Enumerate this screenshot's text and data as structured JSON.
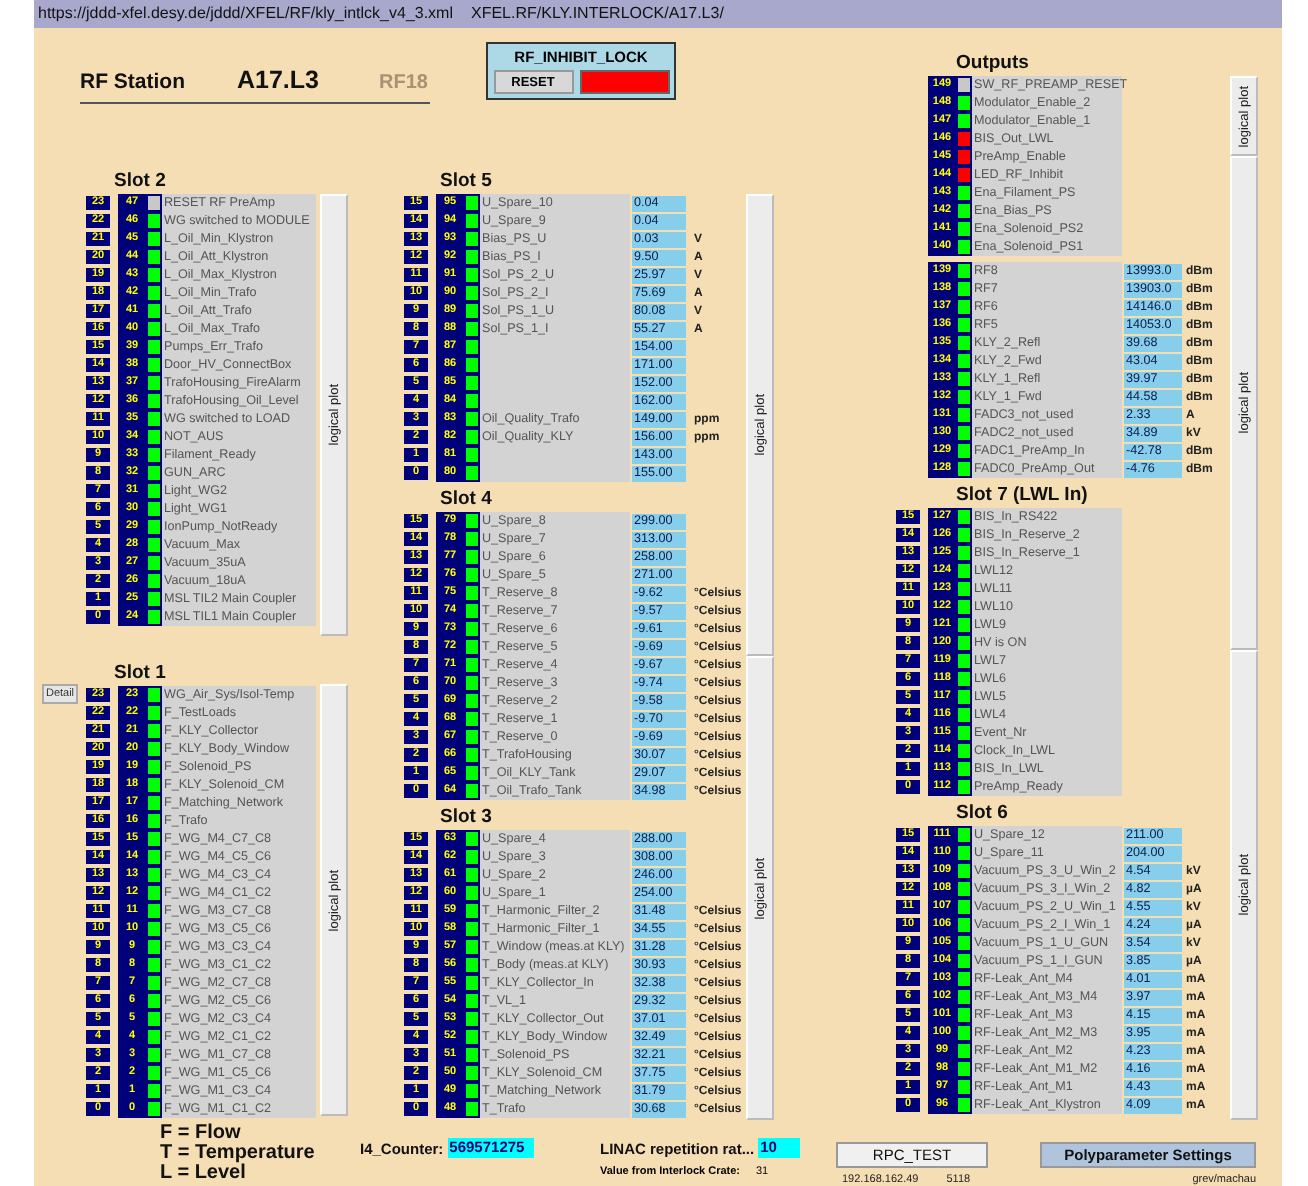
{
  "location": {
    "url": "https://jddd-xfel.desy.de/jddd/XFEL/RF/kly_intlck_v4_3.xml",
    "address": "XFEL.RF/KLY.INTERLOCK/A17.L3/"
  },
  "header": {
    "label": "RF Station",
    "station": "A17.L3",
    "rf_station": {
      "text": "RF18",
      "disabled": true
    }
  },
  "inhibit_lock": {
    "title": "RF_INHIBIT_LOCK",
    "button": "RESET",
    "color": "#ff0000"
  },
  "columns": [
    {
      "plot_buttons": [
        "logical plot",
        "logical plot"
      ],
      "slots": [
        {
          "title": "Slot 2",
          "rows": [
            {
              "index": "23",
              "bit": "47",
              "label": "RESET  RF  PreAmp",
              "color": "#c8c8c8"
            },
            {
              "index": "22",
              "bit": "46",
              "label": "WG switched to MODULE",
              "color": "#00ff00"
            },
            {
              "index": "21",
              "bit": "45",
              "label": "L_Oil_Min_Klystron",
              "color": "#00ff00"
            },
            {
              "index": "20",
              "bit": "44",
              "label": "L_Oil_Att_Klystron",
              "color": "#00ff00"
            },
            {
              "index": "19",
              "bit": "43",
              "label": "L_Oil_Max_Klystron",
              "color": "#00ff00"
            },
            {
              "index": "18",
              "bit": "42",
              "label": "L_Oil_Min_Trafo",
              "color": "#00ff00"
            },
            {
              "index": "17",
              "bit": "41",
              "label": "L_Oil_Att_Trafo",
              "color": "#00ff00"
            },
            {
              "index": "16",
              "bit": "40",
              "label": "L_Oil_Max_Trafo",
              "color": "#00ff00"
            },
            {
              "index": "15",
              "bit": "39",
              "label": "Pumps_Err_Trafo",
              "color": "#00ff00"
            },
            {
              "index": "14",
              "bit": "38",
              "label": "Door_HV_ConnectBox",
              "color": "#00ff00"
            },
            {
              "index": "13",
              "bit": "37",
              "label": "TrafoHousing_FireAlarm",
              "color": "#00ff00"
            },
            {
              "index": "12",
              "bit": "36",
              "label": "TrafoHousing_Oil_Level",
              "color": "#00ff00"
            },
            {
              "index": "11",
              "bit": "35",
              "label": "WG switched to LOAD",
              "color": "#00ff00"
            },
            {
              "index": "10",
              "bit": "34",
              "label": "NOT_AUS",
              "color": "#00ff00"
            },
            {
              "index": "9",
              "bit": "33",
              "label": "Filament_Ready",
              "color": "#00ff00"
            },
            {
              "index": "8",
              "bit": "32",
              "label": "GUN_ARC",
              "color": "#00ff00"
            },
            {
              "index": "7",
              "bit": "31",
              "label": "Light_WG2",
              "color": "#00ff00"
            },
            {
              "index": "6",
              "bit": "30",
              "label": "Light_WG1",
              "color": "#00ff00"
            },
            {
              "index": "5",
              "bit": "29",
              "label": "IonPump_NotReady",
              "color": "#00ff00"
            },
            {
              "index": "4",
              "bit": "28",
              "label": "Vacuum_Max",
              "color": "#00ff00"
            },
            {
              "index": "3",
              "bit": "27",
              "label": "Vacuum_35uA",
              "color": "#00ff00"
            },
            {
              "index": "2",
              "bit": "26",
              "label": "Vacuum_18uA",
              "color": "#00ff00"
            },
            {
              "index": "1",
              "bit": "25",
              "label": "MSL TIL2 Main Coupler",
              "color": "#00ff00"
            },
            {
              "index": "0",
              "bit": "24",
              "label": "MSL TIL1 Main Coupler",
              "color": "#00ff00"
            }
          ]
        },
        {
          "title": "Slot 1",
          "detail_button": "Detail",
          "rows": [
            {
              "index": "23",
              "bit": "23",
              "label": "WG_Air_Sys/Isol-Temp",
              "color": "#00ff00"
            },
            {
              "index": "22",
              "bit": "22",
              "label": "F_TestLoads",
              "color": "#00ff00"
            },
            {
              "index": "21",
              "bit": "21",
              "label": "F_KLY_Collector",
              "color": "#00ff00"
            },
            {
              "index": "20",
              "bit": "20",
              "label": "F_KLY_Body_Window",
              "color": "#00ff00"
            },
            {
              "index": "19",
              "bit": "19",
              "label": "F_Solenoid_PS",
              "color": "#00ff00"
            },
            {
              "index": "18",
              "bit": "18",
              "label": "F_KLY_Solenoid_CM",
              "color": "#00ff00"
            },
            {
              "index": "17",
              "bit": "17",
              "label": "F_Matching_Network",
              "color": "#00ff00"
            },
            {
              "index": "16",
              "bit": "16",
              "label": "F_Trafo",
              "color": "#00ff00"
            },
            {
              "index": "15",
              "bit": "15",
              "label": "F_WG_M4_C7_C8",
              "color": "#00ff00"
            },
            {
              "index": "14",
              "bit": "14",
              "label": "F_WG_M4_C5_C6",
              "color": "#00ff00"
            },
            {
              "index": "13",
              "bit": "13",
              "label": "F_WG_M4_C3_C4",
              "color": "#00ff00"
            },
            {
              "index": "12",
              "bit": "12",
              "label": "F_WG_M4_C1_C2",
              "color": "#00ff00"
            },
            {
              "index": "11",
              "bit": "11",
              "label": "F_WG_M3_C7_C8",
              "color": "#00ff00"
            },
            {
              "index": "10",
              "bit": "10",
              "label": "F_WG_M3_C5_C6",
              "color": "#00ff00"
            },
            {
              "index": "9",
              "bit": "9",
              "label": "F_WG_M3_C3_C4",
              "color": "#00ff00"
            },
            {
              "index": "8",
              "bit": "8",
              "label": "F_WG_M3_C1_C2",
              "color": "#00ff00"
            },
            {
              "index": "7",
              "bit": "7",
              "label": "F_WG_M2_C7_C8",
              "color": "#00ff00"
            },
            {
              "index": "6",
              "bit": "6",
              "label": "F_WG_M2_C5_C6",
              "color": "#00ff00"
            },
            {
              "index": "5",
              "bit": "5",
              "label": "F_WG_M2_C3_C4",
              "color": "#00ff00"
            },
            {
              "index": "4",
              "bit": "4",
              "label": "F_WG_M2_C1_C2",
              "color": "#00ff00"
            },
            {
              "index": "3",
              "bit": "3",
              "label": "F_WG_M1_C7_C8",
              "color": "#00ff00"
            },
            {
              "index": "2",
              "bit": "2",
              "label": "F_WG_M1_C5_C6",
              "color": "#00ff00"
            },
            {
              "index": "1",
              "bit": "1",
              "label": "F_WG_M1_C3_C4",
              "color": "#00ff00"
            },
            {
              "index": "0",
              "bit": "0",
              "label": "F_WG_M1_C1_C2",
              "color": "#00ff00"
            }
          ]
        }
      ]
    },
    {
      "plot_buttons": [
        "logical plot",
        "logical plot"
      ],
      "slots": [
        {
          "title": "Slot 5",
          "rows": [
            {
              "index": "15",
              "bit": "95",
              "label": "U_Spare_10",
              "color": "#00ff00",
              "value": "0.04"
            },
            {
              "index": "14",
              "bit": "94",
              "label": "U_Spare_9",
              "color": "#00ff00",
              "value": "0.04"
            },
            {
              "index": "13",
              "bit": "93",
              "label": "Bias_PS_U",
              "color": "#00ff00",
              "value": "0.03",
              "unit": "V"
            },
            {
              "index": "12",
              "bit": "92",
              "label": "Bias_PS_I",
              "color": "#00ff00",
              "value": "9.50",
              "unit": "A"
            },
            {
              "index": "11",
              "bit": "91",
              "label": "Sol_PS_2_U",
              "color": "#00ff00",
              "value": "25.97",
              "unit": "V"
            },
            {
              "index": "10",
              "bit": "90",
              "label": "Sol_PS_2_I",
              "color": "#00ff00",
              "value": "75.69",
              "unit": "A"
            },
            {
              "index": "9",
              "bit": "89",
              "label": "Sol_PS_1_U",
              "color": "#00ff00",
              "value": "80.08",
              "unit": "V"
            },
            {
              "index": "8",
              "bit": "88",
              "label": "Sol_PS_1_I",
              "color": "#00ff00",
              "value": "55.27",
              "unit": "A"
            },
            {
              "index": "7",
              "bit": "87",
              "color": "#00ff00",
              "value": "154.00"
            },
            {
              "index": "6",
              "bit": "86",
              "color": "#00ff00",
              "value": "171.00"
            },
            {
              "index": "5",
              "bit": "85",
              "color": "#00ff00",
              "value": "152.00"
            },
            {
              "index": "4",
              "bit": "84",
              "color": "#00ff00",
              "value": "162.00"
            },
            {
              "index": "3",
              "bit": "83",
              "label": "Oil_Quality_Trafo",
              "color": "#00ff00",
              "value": "149.00",
              "unit": "ppm"
            },
            {
              "index": "2",
              "bit": "82",
              "label": "Oil_Quality_KLY",
              "color": "#00ff00",
              "value": "156.00",
              "unit": "ppm"
            },
            {
              "index": "1",
              "bit": "81",
              "color": "#00ff00",
              "value": "143.00"
            },
            {
              "index": "0",
              "bit": "80",
              "color": "#00ff00",
              "value": "155.00"
            }
          ]
        },
        {
          "title": "Slot 4",
          "rows": [
            {
              "index": "15",
              "bit": "79",
              "label": "U_Spare_8",
              "color": "#00ff00",
              "value": "299.00"
            },
            {
              "index": "14",
              "bit": "78",
              "label": "U_Spare_7",
              "color": "#00ff00",
              "value": "313.00"
            },
            {
              "index": "13",
              "bit": "77",
              "label": "U_Spare_6",
              "color": "#00ff00",
              "value": "258.00"
            },
            {
              "index": "12",
              "bit": "76",
              "label": "U_Spare_5",
              "color": "#00ff00",
              "value": "271.00"
            },
            {
              "index": "11",
              "bit": "75",
              "label": "T_Reserve_8",
              "color": "#00ff00",
              "value": "-9.62",
              "unit": "°Celsius"
            },
            {
              "index": "10",
              "bit": "74",
              "label": "T_Reserve_7",
              "color": "#00ff00",
              "value": "-9.57",
              "unit": "°Celsius"
            },
            {
              "index": "9",
              "bit": "73",
              "label": "T_Reserve_6",
              "color": "#00ff00",
              "value": "-9.61",
              "unit": "°Celsius"
            },
            {
              "index": "8",
              "bit": "72",
              "label": "T_Reserve_5",
              "color": "#00ff00",
              "value": "-9.69",
              "unit": "°Celsius"
            },
            {
              "index": "7",
              "bit": "71",
              "label": "T_Reserve_4",
              "color": "#00ff00",
              "value": "-9.67",
              "unit": "°Celsius"
            },
            {
              "index": "6",
              "bit": "70",
              "label": "T_Reserve_3",
              "color": "#00ff00",
              "value": "-9.74",
              "unit": "°Celsius"
            },
            {
              "index": "5",
              "bit": "69",
              "label": "T_Reserve_2",
              "color": "#00ff00",
              "value": "-9.58",
              "unit": "°Celsius"
            },
            {
              "index": "4",
              "bit": "68",
              "label": "T_Reserve_1",
              "color": "#00ff00",
              "value": "-9.70",
              "unit": "°Celsius"
            },
            {
              "index": "3",
              "bit": "67",
              "label": "T_Reserve_0",
              "color": "#00ff00",
              "value": "-9.69",
              "unit": "°Celsius"
            },
            {
              "index": "2",
              "bit": "66",
              "label": "T_TrafoHousing",
              "color": "#00ff00",
              "value": "30.07",
              "unit": "°Celsius"
            },
            {
              "index": "1",
              "bit": "65",
              "label": "T_Oil_KLY_Tank",
              "color": "#00ff00",
              "value": "29.07",
              "unit": "°Celsius"
            },
            {
              "index": "0",
              "bit": "64",
              "label": "T_Oil_Trafo_Tank",
              "color": "#00ff00",
              "value": "34.98",
              "unit": "°Celsius"
            }
          ]
        },
        {
          "title": "Slot 3",
          "rows": [
            {
              "index": "15",
              "bit": "63",
              "label": "U_Spare_4",
              "color": "#00ff00",
              "value": "288.00"
            },
            {
              "index": "14",
              "bit": "62",
              "label": "U_Spare_3",
              "color": "#00ff00",
              "value": "308.00"
            },
            {
              "index": "13",
              "bit": "61",
              "label": "U_Spare_2",
              "color": "#00ff00",
              "value": "246.00"
            },
            {
              "index": "12",
              "bit": "60",
              "label": "U_Spare_1",
              "color": "#00ff00",
              "value": "254.00"
            },
            {
              "index": "11",
              "bit": "59",
              "label": "T_Harmonic_Filter_2",
              "color": "#00ff00",
              "value": "31.48",
              "unit": "°Celsius"
            },
            {
              "index": "10",
              "bit": "58",
              "label": "T_Harmonic_Filter_1",
              "color": "#00ff00",
              "value": "34.55",
              "unit": "°Celsius"
            },
            {
              "index": "9",
              "bit": "57",
              "label": "T_Window (meas.at KLY)",
              "color": "#00ff00",
              "value": "31.28",
              "unit": "°Celsius"
            },
            {
              "index": "8",
              "bit": "56",
              "label": "T_Body (meas.at KLY)",
              "color": "#00ff00",
              "value": "30.93",
              "unit": "°Celsius"
            },
            {
              "index": "7",
              "bit": "55",
              "label": "T_KLY_Collector_In",
              "color": "#00ff00",
              "value": "32.38",
              "unit": "°Celsius"
            },
            {
              "index": "6",
              "bit": "54",
              "label": "T_VL_1",
              "color": "#00ff00",
              "value": "29.32",
              "unit": "°Celsius"
            },
            {
              "index": "5",
              "bit": "53",
              "label": "T_KLY_Collector_Out",
              "color": "#00ff00",
              "value": "37.01",
              "unit": "°Celsius"
            },
            {
              "index": "4",
              "bit": "52",
              "label": "T_KLY_Body_Window",
              "color": "#00ff00",
              "value": "32.49",
              "unit": "°Celsius"
            },
            {
              "index": "3",
              "bit": "51",
              "label": "T_Solenoid_PS",
              "color": "#00ff00",
              "value": "32.21",
              "unit": "°Celsius"
            },
            {
              "index": "2",
              "bit": "50",
              "label": "T_KLY_Solenoid_CM",
              "color": "#00ff00",
              "value": "37.75",
              "unit": "°Celsius"
            },
            {
              "index": "1",
              "bit": "49",
              "label": "T_Matching_Network",
              "color": "#00ff00",
              "value": "31.79",
              "unit": "°Celsius"
            },
            {
              "index": "0",
              "bit": "48",
              "label": "T_Trafo",
              "color": "#00ff00",
              "value": "30.68",
              "unit": "°Celsius"
            }
          ]
        }
      ]
    },
    {
      "plot_buttons": [
        "logical plot",
        "logical plot",
        "logical plot"
      ],
      "slots": [
        {
          "title": "Outputs",
          "rows": [
            {
              "bit": "149",
              "label": "SW_RF_PREAMP_RESET",
              "color": "#c8c8c8"
            },
            {
              "bit": "148",
              "label": "Modulator_Enable_2",
              "color": "#00ff00"
            },
            {
              "bit": "147",
              "label": "Modulator_Enable_1",
              "color": "#00ff00"
            },
            {
              "bit": "146",
              "label": "BIS_Out_LWL",
              "color": "#ff0000"
            },
            {
              "bit": "145",
              "label": "PreAmp_Enable",
              "color": "#ff0000"
            },
            {
              "bit": "144",
              "label": "LED_RF_Inhibit",
              "color": "#ff0000"
            },
            {
              "bit": "143",
              "label": "Ena_Filament_PS",
              "color": "#00ff00"
            },
            {
              "bit": "142",
              "label": "Ena_Bias_PS",
              "color": "#00ff00"
            },
            {
              "bit": "141",
              "label": "Ena_Solenoid_PS2",
              "color": "#00ff00"
            },
            {
              "bit": "140",
              "label": "Ena_Solenoid_PS1",
              "color": "#00ff00"
            }
          ]
        },
        {
          "rows": [
            {
              "bit": "139",
              "label": "RF8",
              "color": "#00ff00",
              "value": "13993.0",
              "unit": "dBm"
            },
            {
              "bit": "138",
              "label": "RF7",
              "color": "#00ff00",
              "value": "13903.0",
              "unit": "dBm"
            },
            {
              "bit": "137",
              "label": "RF6",
              "color": "#00ff00",
              "value": "14146.0",
              "unit": "dBm"
            },
            {
              "bit": "136",
              "label": "RF5",
              "color": "#00ff00",
              "value": "14053.0",
              "unit": "dBm"
            },
            {
              "bit": "135",
              "label": "KLY_2_Refl",
              "color": "#00ff00",
              "value": "39.68",
              "unit": "dBm"
            },
            {
              "bit": "134",
              "label": "KLY_2_Fwd",
              "color": "#00ff00",
              "value": "43.04",
              "unit": "dBm"
            },
            {
              "bit": "133",
              "label": "KLY_1_Refl",
              "color": "#00ff00",
              "value": "39.97",
              "unit": "dBm"
            },
            {
              "bit": "132",
              "label": "KLY_1_Fwd",
              "color": "#00ff00",
              "value": "44.58",
              "unit": "dBm"
            },
            {
              "bit": "131",
              "label": "FADC3_not_used",
              "color": "#00ff00",
              "value": "2.33",
              "unit": "A"
            },
            {
              "bit": "130",
              "label": "FADC2_not_used",
              "color": "#00ff00",
              "value": "34.89",
              "unit": "kV"
            },
            {
              "bit": "129",
              "label": "FADC1_PreAmp_In",
              "color": "#00ff00",
              "value": "-42.78",
              "unit": "dBm"
            },
            {
              "bit": "128",
              "label": "FADC0_PreAmp_Out",
              "color": "#00ff00",
              "value": "-4.76",
              "unit": "dBm"
            }
          ]
        },
        {
          "title": "Slot 7 (LWL In)",
          "rows": [
            {
              "index": "15",
              "bit": "127",
              "label": "BIS_In_RS422",
              "color": "#00ff00"
            },
            {
              "index": "14",
              "bit": "126",
              "label": "BIS_In_Reserve_2",
              "color": "#00ff00"
            },
            {
              "index": "13",
              "bit": "125",
              "label": "BIS_In_Reserve_1",
              "color": "#00ff00"
            },
            {
              "index": "12",
              "bit": "124",
              "label": "LWL12",
              "color": "#00ff00"
            },
            {
              "index": "11",
              "bit": "123",
              "label": "LWL11",
              "color": "#00ff00"
            },
            {
              "index": "10",
              "bit": "122",
              "label": "LWL10",
              "color": "#00ff00"
            },
            {
              "index": "9",
              "bit": "121",
              "label": "LWL9",
              "color": "#00ff00"
            },
            {
              "index": "8",
              "bit": "120",
              "label": "HV is ON",
              "color": "#00ff00"
            },
            {
              "index": "7",
              "bit": "119",
              "label": "LWL7",
              "color": "#00ff00"
            },
            {
              "index": "6",
              "bit": "118",
              "label": "LWL6",
              "color": "#00ff00"
            },
            {
              "index": "5",
              "bit": "117",
              "label": "LWL5",
              "color": "#00ff00"
            },
            {
              "index": "4",
              "bit": "116",
              "label": "LWL4",
              "color": "#00ff00"
            },
            {
              "index": "3",
              "bit": "115",
              "label": "Event_Nr",
              "color": "#00ff00"
            },
            {
              "index": "2",
              "bit": "114",
              "label": "Clock_In_LWL",
              "color": "#00ff00"
            },
            {
              "index": "1",
              "bit": "113",
              "label": "BIS_In_LWL",
              "color": "#00ff00"
            },
            {
              "index": "0",
              "bit": "112",
              "label": "PreAmp_Ready",
              "color": "#00ff00"
            }
          ]
        },
        {
          "title": "Slot 6",
          "rows": [
            {
              "index": "15",
              "bit": "111",
              "label": "U_Spare_12",
              "color": "#00ff00",
              "value": "211.00"
            },
            {
              "index": "14",
              "bit": "110",
              "label": "U_Spare_11",
              "color": "#00ff00",
              "value": "204.00"
            },
            {
              "index": "13",
              "bit": "109",
              "label": "Vacuum_PS_3_U_Win_2",
              "color": "#00ff00",
              "value": "4.54",
              "unit": "kV"
            },
            {
              "index": "12",
              "bit": "108",
              "label": "Vacuum_PS_3_I_Win_2",
              "color": "#00ff00",
              "value": "4.82",
              "unit": "µA"
            },
            {
              "index": "11",
              "bit": "107",
              "label": "Vacuum_PS_2_U_Win_1",
              "color": "#00ff00",
              "value": "4.55",
              "unit": "kV"
            },
            {
              "index": "10",
              "bit": "106",
              "label": "Vacuum_PS_2_I_Win_1",
              "color": "#00ff00",
              "value": "4.24",
              "unit": "µA"
            },
            {
              "index": "9",
              "bit": "105",
              "label": "Vacuum_PS_1_U_GUN",
              "color": "#00ff00",
              "value": "3.54",
              "unit": "kV"
            },
            {
              "index": "8",
              "bit": "104",
              "label": "Vacuum_PS_1_I_GUN",
              "color": "#00ff00",
              "value": "3.85",
              "unit": "µA"
            },
            {
              "index": "7",
              "bit": "103",
              "label": "RF-Leak_Ant_M4",
              "color": "#00ff00",
              "value": "4.01",
              "unit": "mA"
            },
            {
              "index": "6",
              "bit": "102",
              "label": "RF-Leak_Ant_M3_M4",
              "color": "#00ff00",
              "value": "3.97",
              "unit": "mA"
            },
            {
              "index": "5",
              "bit": "101",
              "label": "RF-Leak_Ant_M3",
              "color": "#00ff00",
              "value": "4.15",
              "unit": "mA"
            },
            {
              "index": "4",
              "bit": "100",
              "label": "RF-Leak_Ant_M2_M3",
              "color": "#00ff00",
              "value": "3.95",
              "unit": "mA"
            },
            {
              "index": "3",
              "bit": "99",
              "label": "RF-Leak_Ant_M2",
              "color": "#00ff00",
              "value": "4.23",
              "unit": "mA"
            },
            {
              "index": "2",
              "bit": "98",
              "label": "RF-Leak_Ant_M1_M2",
              "color": "#00ff00",
              "value": "4.16",
              "unit": "mA"
            },
            {
              "index": "1",
              "bit": "97",
              "label": "RF-Leak_Ant_M1",
              "color": "#00ff00",
              "value": "4.43",
              "unit": "mA"
            },
            {
              "index": "0",
              "bit": "96",
              "label": "RF-Leak_Ant_Klystron",
              "color": "#00ff00",
              "value": "4.09",
              "unit": "mA"
            }
          ]
        }
      ]
    }
  ],
  "legend": [
    "F = Flow",
    "T = Temperature",
    "L = Level"
  ],
  "counter": {
    "label": "I4_Counter:",
    "value": "569571275"
  },
  "linac": {
    "label": "LINAC repetition rat...",
    "value": "10",
    "note": "Value from Interlock Crate:",
    "note_value": "31"
  },
  "rpc": {
    "button": "RPC_TEST",
    "host": "192.168.162.49",
    "port": "5118"
  },
  "poly": {
    "button": "Polyparameter Settings",
    "user": "grev/machau"
  }
}
